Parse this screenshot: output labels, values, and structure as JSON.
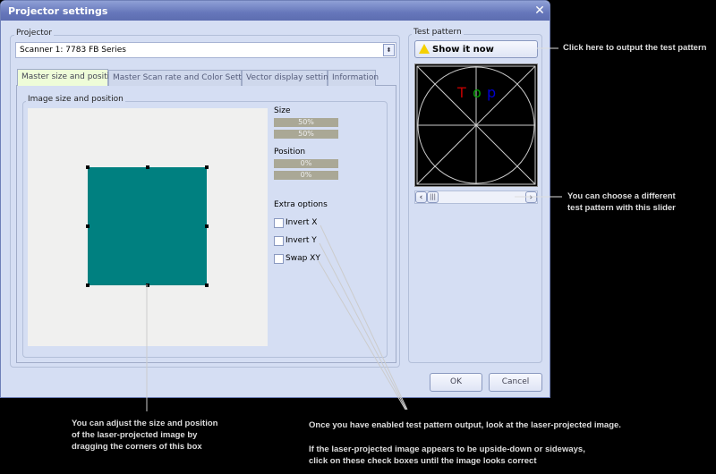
{
  "window": {
    "title": "Projector settings",
    "close_icon": "close-icon"
  },
  "projector": {
    "group_label": "Projector",
    "selected": "Scanner 1: 7783 FB Series"
  },
  "tabs": [
    {
      "label": "Master size and position",
      "active": true
    },
    {
      "label": "Master Scan rate and Color Settings",
      "active": false
    },
    {
      "label": "Vector display settings",
      "active": false
    },
    {
      "label": "Information",
      "active": false
    }
  ],
  "image_group": {
    "label": "Image size and position",
    "box_color": "#008080"
  },
  "size": {
    "label": "Size",
    "values": [
      "50%",
      "50%"
    ]
  },
  "position": {
    "label": "Position",
    "values": [
      "0%",
      "0%"
    ]
  },
  "extra": {
    "label": "Extra options",
    "options": [
      {
        "label": "Invert X",
        "checked": false
      },
      {
        "label": "Invert Y",
        "checked": false
      },
      {
        "label": "Swap XY",
        "checked": false
      }
    ]
  },
  "test_pattern": {
    "group_label": "Test pattern",
    "button_label": "Show it now",
    "button_icon": "warning-icon",
    "pattern_text": [
      "T",
      "o",
      "p"
    ],
    "pattern_colors": [
      "#c00000",
      "#00a000",
      "#0000d0"
    ],
    "slider_position": 0
  },
  "buttons": {
    "ok": "OK",
    "cancel": "Cancel"
  },
  "annotations": {
    "show": "Click here to output the test pattern",
    "slider": [
      "You can choose a different",
      "test pattern with this slider"
    ],
    "box": [
      "You can adjust the size and position",
      "of the laser-projected image by",
      "dragging the corners of this box"
    ],
    "checks": [
      "Once you have enabled test pattern output, look at the laser-projected image.",
      "",
      "If the laser-projected image appears to be upside-down or sideways,",
      "click on these check boxes until the image looks correct"
    ]
  }
}
